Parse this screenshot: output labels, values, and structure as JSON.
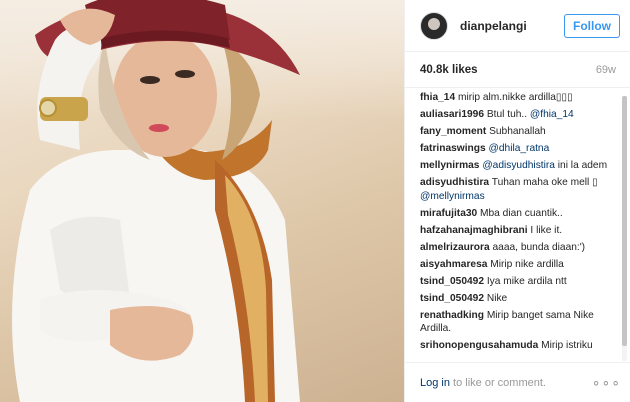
{
  "post": {
    "username": "dianpelangi",
    "follow_label": "Follow",
    "likes": "40.8k likes",
    "age": "69w"
  },
  "comments": [
    {
      "user": "fhia_14",
      "text": "mirip alm.nikke ardilla▯▯▯"
    },
    {
      "user": "auliasari1996",
      "text": "Btul tuh.. ",
      "mention": "@fhia_14"
    },
    {
      "user": "fany_moment",
      "text": "Subhanallah"
    },
    {
      "user": "fatrinaswings",
      "text": "",
      "mention": "@dhila_ratna"
    },
    {
      "user": "mellynirmas",
      "text": " ini la adem",
      "mention_first": "@adisyudhistira"
    },
    {
      "user": "adisyudhistira",
      "text": "Tuhan maha oke mell ▯ ",
      "mention": "@mellynirmas"
    },
    {
      "user": "mirafujita30",
      "text": "Mba dian cuantik.."
    },
    {
      "user": "hafzahanajmaghibrani",
      "text": "I like it."
    },
    {
      "user": "almelrizaurora",
      "text": "aaaa, bunda diaan:')"
    },
    {
      "user": "aisyahmaresa",
      "text": "Mirip nike ardilla"
    },
    {
      "user": "tsind_050492",
      "text": "Iya mike ardila ntt"
    },
    {
      "user": "tsind_050492",
      "text": "Nike"
    },
    {
      "user": "renathadking",
      "text": "Mirip banget sama Nike Ardilla."
    },
    {
      "user": "srihonopengusahamuda",
      "text": "Mirip istriku"
    }
  ],
  "footer": {
    "login_link": "Log in",
    "login_rest": " to like or comment.",
    "more_label": "∘∘∘"
  }
}
